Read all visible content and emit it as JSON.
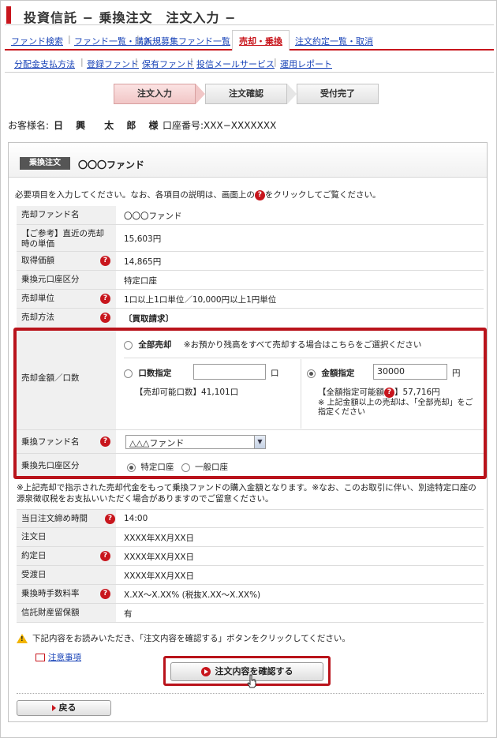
{
  "title": "投資信託 − 乗換注文　注文入力 −",
  "nav_primary": [
    {
      "label": "ファンド検索"
    },
    {
      "label": "ファンド一覧・購入"
    },
    {
      "label": "新規募集ファンド一覧"
    },
    {
      "label": "売却・乗換"
    },
    {
      "label": "注文約定一覧・取消"
    }
  ],
  "nav_secondary": [
    {
      "label": "分配金支払方法"
    },
    {
      "label": "登録ファンド"
    },
    {
      "label": "保有ファンド"
    },
    {
      "label": "投信メールサービス"
    },
    {
      "label": "運用レポート"
    }
  ],
  "steps": [
    {
      "label": "注文入力"
    },
    {
      "label": "注文確認"
    },
    {
      "label": "受付完了"
    }
  ],
  "customer": {
    "name_label": "お客様名:",
    "name": "日 興　太 郎 様",
    "account": "口座番号:XXX−XXXXXXX"
  },
  "order": {
    "badge": "乗換注文",
    "fund": "〇〇〇ファンド",
    "instruction": "必要項目を入力してください。なお、各項目の説明は、画面上の",
    "instruction_tail": "をクリックしてご覧ください。",
    "help_glyph": "?"
  },
  "rows": {
    "sell_fund": {
      "label": "売却ファンド名",
      "value": "〇〇〇ファンド"
    },
    "ref_price": {
      "label": "【ご参考】直近の売却時の単価",
      "value": "15,603円"
    },
    "acq_price": {
      "label": "取得価額",
      "value": "14,865円"
    },
    "src_account": {
      "label": "乗換元口座区分",
      "value": "特定口座"
    },
    "sell_unit": {
      "label": "売却単位",
      "value": "1口以上1口単位／10,000円以上1円単位"
    },
    "sell_method": {
      "label": "売却方法",
      "value": "〔買取請求〕"
    },
    "amount": {
      "label": "売却金額／口数",
      "all_label": "全部売却",
      "all_note": "※お預かり残高をすべて売却する場合はこちらをご選択ください",
      "units_label": "口数指定",
      "units_value": "",
      "units_suffix": "口",
      "units_available": "【売却可能口数】41,101口",
      "amount_label": "金額指定",
      "amount_value": "30000",
      "amount_suffix": "円",
      "amount_available_label": "【全額指定可能額",
      "amount_available_value": "】57,716円",
      "amount_note": "※ 上記金額以上の売却は、「全部売却」をご指定ください"
    },
    "switch_fund": {
      "label": "乗換ファンド名",
      "value": "△△△ファンド"
    },
    "dest_account": {
      "label": "乗換先口座区分",
      "option1": "特定口座",
      "option2": "一般口座"
    },
    "note": "※上記売却で指示された売却代金をもって乗換ファンドの購入金額となります。※なお、このお取引に伴い、別途特定口座の源泉徴収税をお支払いいただく場合がありますのでご留意ください。",
    "cutoff": {
      "label": "当日注文締め時間",
      "value": "14:00"
    },
    "order_date": {
      "label": "注文日",
      "value": "XXXX年XX月XX日"
    },
    "trade_date": {
      "label": "約定日",
      "value": "XXXX年XX月XX日"
    },
    "delivery_date": {
      "label": "受渡日",
      "value": "XXXX年XX月XX日"
    },
    "fee": {
      "label": "乗換時手数料率",
      "value": "X.XX～X.XX% (税抜X.XX～X.XX%)"
    },
    "reserve": {
      "label": "信託財産留保額",
      "value": "有"
    }
  },
  "footer": {
    "warning": "下記内容をお読みいただき、「注文内容を確認する」ボタンをクリックしてください。",
    "notes_link": "注意事項",
    "confirm_button": "注文内容を確認する",
    "back_button": "戻る",
    "warn_glyph": "!"
  },
  "colors": {
    "accent": "#c8161d",
    "highlight": "#b9131b",
    "link": "#1a44b8"
  }
}
